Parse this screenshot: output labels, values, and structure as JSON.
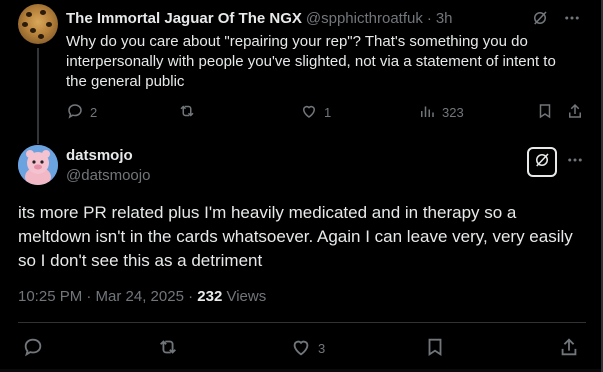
{
  "reply": {
    "author_name": "The Immortal Jaguar Of The NGX",
    "handle": "@spphicthroatfuk",
    "separator": "·",
    "time": "3h",
    "text": "Why do you care about \"repairing your rep\"? That's something you do interpersonally with people you've slighted, not via a statement of intent to the general public",
    "stats": {
      "replies": "2",
      "reposts": "",
      "likes": "1",
      "views": "323"
    }
  },
  "main": {
    "author_name": "datsmojo",
    "handle": "@datsmoojo",
    "text": "its more PR related plus I'm heavily medicated and in therapy so a meltdown isn't in the cards whatsoever. Again I can leave very, very easily so I don't see this as a detriment",
    "timestamp": "10:25 PM · Mar 24, 2025 · ",
    "views_count": "232",
    "views_label": " Views",
    "stats": {
      "replies": "",
      "reposts": "",
      "likes": "3"
    }
  },
  "colors": {
    "background": "#000000",
    "text": "#e7e9ea",
    "muted": "#71767b",
    "border": "#2f3336"
  },
  "icons": [
    "grok-icon",
    "more-icon",
    "reply-icon",
    "repost-icon",
    "like-icon",
    "views-icon",
    "bookmark-icon",
    "share-icon"
  ]
}
